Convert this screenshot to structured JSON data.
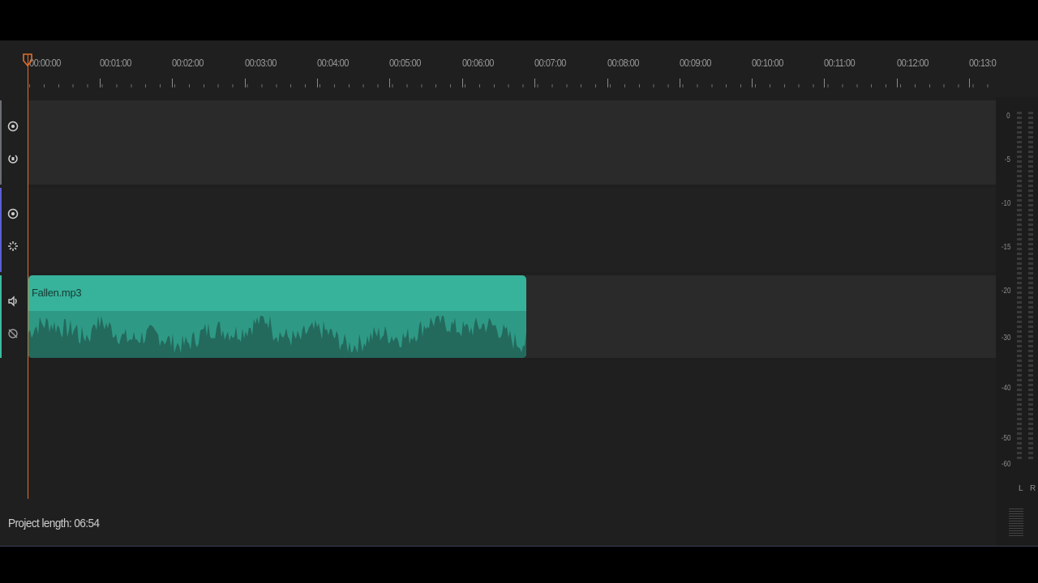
{
  "ruler": {
    "labels": [
      "00:00:00",
      "00:01:00",
      "00:02:00",
      "00:03:00",
      "00:04:00",
      "00:05:00",
      "00:06:00",
      "00:07:00",
      "00:08:00",
      "00:09:00",
      "00:10:00",
      "00:11:00",
      "00:12:00",
      "00:13:0"
    ]
  },
  "tracks": [
    {
      "kind": "video-1",
      "icons": [
        "eye-icon",
        "lock-icon"
      ],
      "accent": "#6b6f74"
    },
    {
      "kind": "video-2",
      "icons": [
        "eye-icon",
        "effect-icon"
      ],
      "accent": "#5b5fd6"
    },
    {
      "kind": "audio",
      "icons": [
        "speaker-icon",
        "mute-icon"
      ],
      "accent": "#3dbb9f"
    }
  ],
  "clip": {
    "name": "Fallen.mp3",
    "color": "#37b29b",
    "wave_color": "#23695c"
  },
  "playhead": {
    "color": "#e2702a"
  },
  "meter": {
    "scale": [
      "0",
      "-5",
      "-10",
      "-15",
      "-20",
      "-30",
      "-40",
      "-50",
      "-60"
    ],
    "left": "L",
    "right": "R"
  },
  "status": {
    "project_length": "Project length: 06:54"
  }
}
